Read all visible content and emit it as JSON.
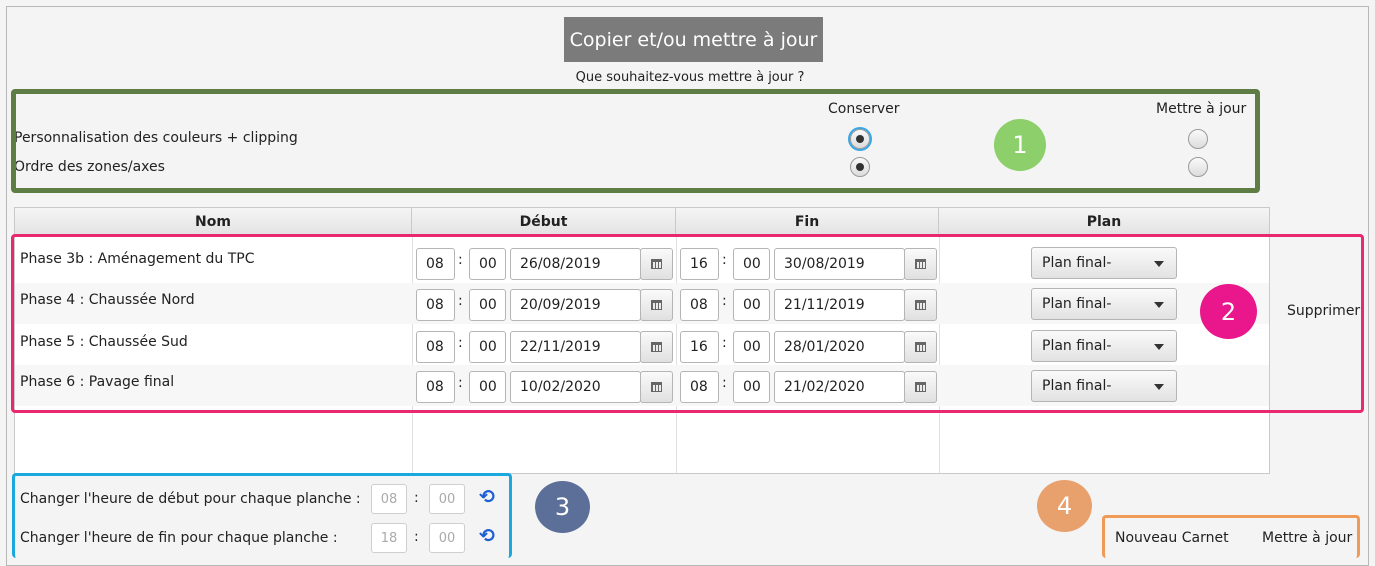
{
  "dialog": {
    "title": "Copier et/ou mettre à jour",
    "question": "Que souhaitez-vous mettre à jour ?"
  },
  "options": {
    "col_keep": "Conserver",
    "col_update": "Mettre à jour",
    "rows": [
      {
        "label": "Personnalisation des couleurs  + clipping",
        "selected": "keep"
      },
      {
        "label": "Ordre des zones/axes",
        "selected": "keep"
      }
    ]
  },
  "table": {
    "headers": [
      "Nom",
      "Début",
      "Fin",
      "Plan"
    ],
    "rows": [
      {
        "name": "Phase 3b : Aménagement du TPC",
        "start_h": "08",
        "start_m": "00",
        "start_date": "26/08/2019",
        "end_h": "16",
        "end_m": "00",
        "end_date": "30/08/2019",
        "plan": "Plan final-"
      },
      {
        "name": "Phase 4 : Chaussée Nord",
        "start_h": "08",
        "start_m": "00",
        "start_date": "20/09/2019",
        "end_h": "08",
        "end_m": "00",
        "end_date": "21/11/2019",
        "plan": "Plan final-"
      },
      {
        "name": "Phase 5 : Chaussée Sud",
        "start_h": "08",
        "start_m": "00",
        "start_date": "22/11/2019",
        "end_h": "16",
        "end_m": "00",
        "end_date": "28/01/2020",
        "plan": "Plan final-"
      },
      {
        "name": "Phase 6 : Pavage final",
        "start_h": "08",
        "start_m": "00",
        "start_date": "10/02/2020",
        "end_h": "08",
        "end_m": "00",
        "end_date": "21/02/2020",
        "plan": "Plan final-"
      }
    ],
    "delete_label": "Supprimer"
  },
  "bulk": {
    "start_label": "Changer l'heure de début pour chaque planche :",
    "start_h": "08",
    "start_m": "00",
    "end_label": "Changer l'heure de fin pour chaque planche :",
    "end_h": "18",
    "end_m": "00"
  },
  "footer": {
    "new_label": "Nouveau Carnet",
    "update_label": "Mettre à jour"
  },
  "badges": [
    "1",
    "2",
    "3",
    "4"
  ],
  "colors": {
    "green": "#5e7d45",
    "pink": "#e8286f",
    "blue": "#1aa8df",
    "orange": "#f09a58",
    "badge_green": "#8ccf6b",
    "badge_pink": "#ea168c",
    "badge_slate": "#5b6f99",
    "badge_orange": "#e8a16d"
  }
}
